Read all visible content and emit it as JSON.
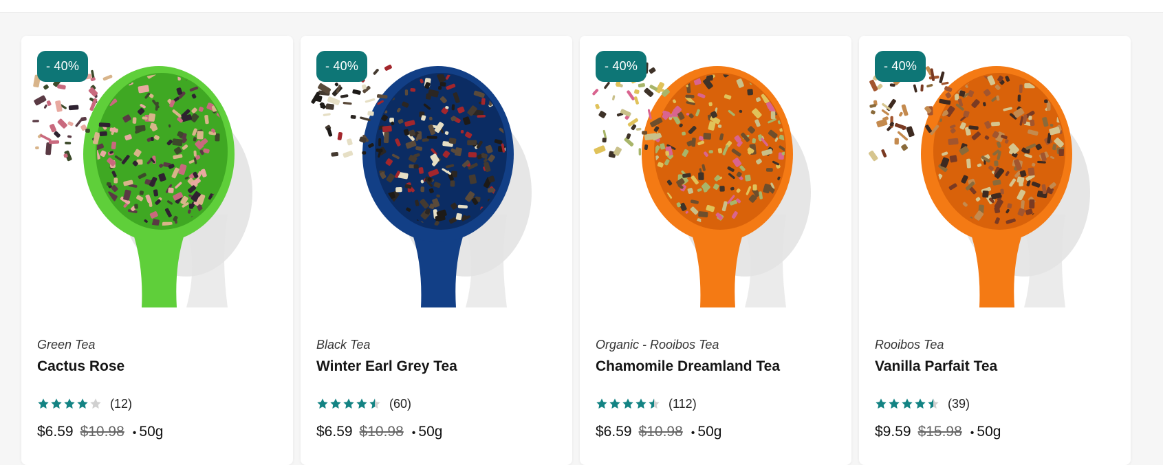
{
  "products": [
    {
      "badge": "- 40%",
      "category": "Green Tea",
      "name": "Cactus Rose",
      "rating": 4.0,
      "reviews": "(12)",
      "price": "$6.59",
      "original_price": "$10.98",
      "separator": "•",
      "weight": "50g",
      "spoon_color": "#5fcf3a",
      "spoon_dark": "#3fa823",
      "leaf_colors": [
        "#5a3a44",
        "#c9697e",
        "#e8a9a0",
        "#3c4a2a",
        "#2e2230",
        "#d8b48a"
      ]
    },
    {
      "badge": "- 40%",
      "category": "Black Tea",
      "name": "Winter Earl Grey Tea",
      "rating": 4.5,
      "reviews": "(60)",
      "price": "$6.59",
      "original_price": "$10.98",
      "separator": "•",
      "weight": "50g",
      "spoon_color": "#123f86",
      "spoon_dark": "#0b2c63",
      "leaf_colors": [
        "#2b2622",
        "#1d1a17",
        "#443a30",
        "#e6dfc5",
        "#a3262c",
        "#5a4a3a"
      ]
    },
    {
      "badge": "- 40%",
      "category": "Organic - Rooibos Tea",
      "name": "Chamomile Dreamland Tea",
      "rating": 4.5,
      "reviews": "(112)",
      "price": "$6.59",
      "original_price": "$10.98",
      "separator": "•",
      "weight": "50g",
      "spoon_color": "#f47a14",
      "spoon_dark": "#d9620a",
      "leaf_colors": [
        "#6e4e2c",
        "#a8b56a",
        "#e0c25a",
        "#d9648f",
        "#3e3228",
        "#c9c08a"
      ]
    },
    {
      "badge": "- 40%",
      "category": "Rooibos Tea",
      "name": "Vanilla Parfait Tea",
      "rating": 4.5,
      "reviews": "(39)",
      "price": "$9.59",
      "original_price": "$15.98",
      "separator": "•",
      "weight": "50g",
      "spoon_color": "#f47a14",
      "spoon_dark": "#d9620a",
      "leaf_colors": [
        "#7a3a22",
        "#a2552e",
        "#d6c58e",
        "#3e2a20",
        "#c48a4e",
        "#8a6a3a"
      ]
    }
  ],
  "colors": {
    "badge": "#0e7676",
    "star_filled": "#138383",
    "star_empty": "#d0d0d0"
  }
}
